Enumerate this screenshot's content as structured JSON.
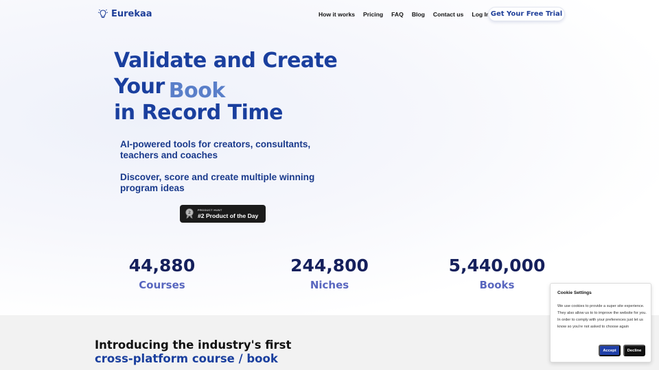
{
  "nav": {
    "brand": "Eurekaa",
    "brand_icon": "lightbulb-icon",
    "links": [
      "How it works",
      "Pricing",
      "FAQ",
      "Blog",
      "Contact us",
      "Log In"
    ],
    "cta": "Get Your Free Trial"
  },
  "hero": {
    "headline_line1": "Validate and Create",
    "headline_line2_prefix": "Your",
    "rotating_word": "Book",
    "headline_line3": "in Record Time",
    "sub1": "AI-powered tools for creators, consultants, teachers and coaches",
    "sub2": "Discover, score and create multiple winning program ideas",
    "badge": {
      "small": "PRODUCT HUNT",
      "big": "#2 Product of the Day",
      "icon": "medal-icon"
    }
  },
  "stats": [
    {
      "value": "44,880",
      "label": "Courses"
    },
    {
      "value": "244,800",
      "label": "Niches"
    },
    {
      "value": "5,440,000",
      "label": "Books"
    }
  ],
  "intro": {
    "line1": "Introducing the industry's first",
    "line2": "cross-platform course / book"
  },
  "cookie": {
    "title": "Cookie Settings",
    "body": "We use cookies to provide a super site experience. They also allow us to to improve the website for you. In order to comply with your preferences just let us know so you're not asked to choose again",
    "accept": "Accept",
    "decline": "Decline"
  },
  "colors": {
    "primary": "#1a3f9e",
    "accent": "#5866bf",
    "stat_number": "#15205c",
    "section_bg": "#f2f2f2"
  }
}
